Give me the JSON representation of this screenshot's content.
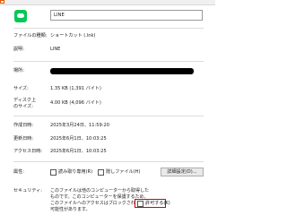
{
  "header": {
    "name_value": "LINE"
  },
  "fields": {
    "file_type_label": "ファイルの種類:",
    "file_type_value": "ショートカット (.lnk)",
    "description_label": "説明:",
    "description_value": "LINE",
    "location_label": "場所:",
    "size_label": "サイズ:",
    "size_value": "1.35 KB (1,391 バイト)",
    "disk_size_label_line1": "ディスク上",
    "disk_size_label_line2": "のサイズ:",
    "disk_size_value": "4.00 KB (4,096 バイト)",
    "created_label": "作成日時:",
    "created_value": "2025年3月24日、11:59:20",
    "modified_label": "更新日時:",
    "modified_value": "2025年6月1日、10:03:25",
    "accessed_label": "アクセス日時:",
    "accessed_value": "2025年6月1日、10:03:25"
  },
  "attributes": {
    "label": "属性:",
    "readonly_label": "読み取り専用(R)",
    "hidden_label": "隠しファイル(H)",
    "advanced_button": "詳細設定(D)..."
  },
  "security": {
    "label": "セキュリティ:",
    "line1": "このファイルは他のコンピューターから取得した",
    "line2": "ものです。このコンピューターを保護するため、",
    "line3": "このファイルへのアクセスはブロックされる",
    "line4": "可能性があります。",
    "allow_label": "許可する(K)",
    "allow_checked": false
  },
  "colors": {
    "highlight": "#d40000",
    "line_green": "#06c755"
  }
}
